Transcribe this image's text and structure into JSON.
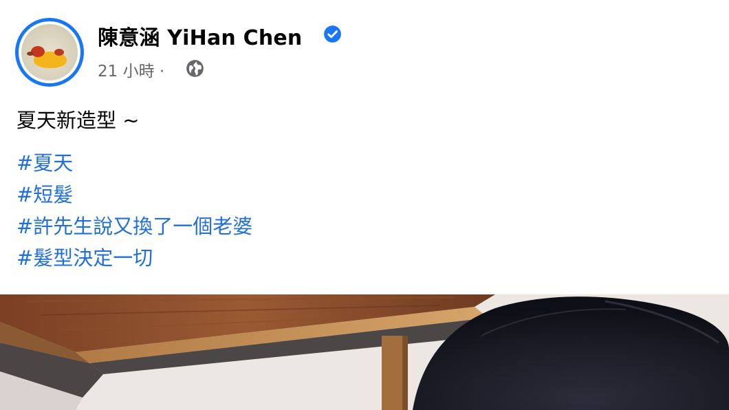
{
  "post": {
    "author_name": "陳意涵 YiHan Chen",
    "timestamp": "21 小時",
    "separator": "·",
    "text": "夏天新造型 ~",
    "hashtags": [
      "#夏天",
      "#短髮",
      "#許先生說又換了一個老婆",
      "#髮型決定一切"
    ]
  },
  "icons": {
    "verified": "verified-badge-icon",
    "audience": "globe-icon"
  },
  "colors": {
    "link": "#216fdb",
    "verified": "#1877f2",
    "meta": "#65676b",
    "text": "#050505"
  }
}
